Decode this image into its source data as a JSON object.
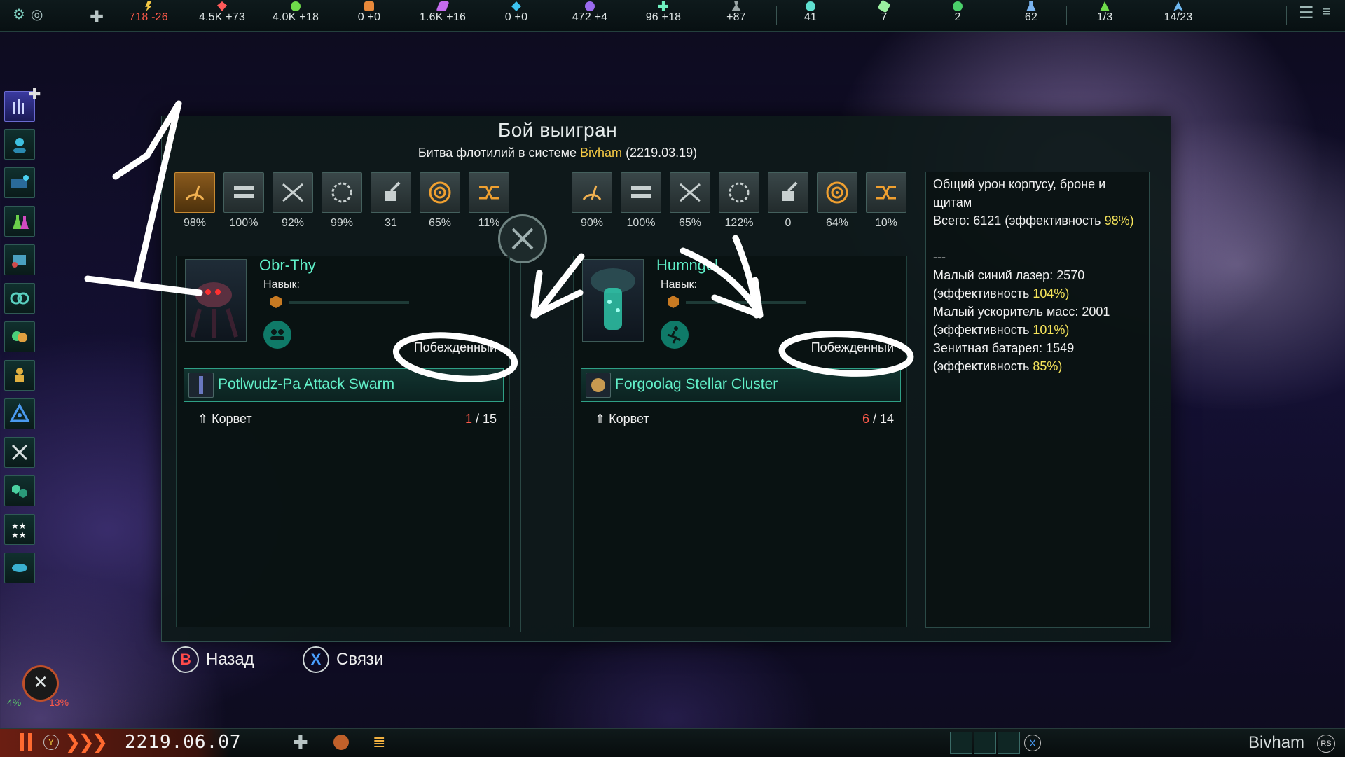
{
  "topbar": {
    "resources": [
      {
        "name": "energy",
        "value": "718 -26",
        "color": "#f2c744",
        "negative": true
      },
      {
        "name": "minerals",
        "value": "4.5K +73",
        "color": "#ff5a5a"
      },
      {
        "name": "food",
        "value": "4.0K +18",
        "color": "#6fdc4a"
      },
      {
        "name": "consumer-goods",
        "value": "0 +0",
        "color": "#e8893a"
      },
      {
        "name": "alloys",
        "value": "1.6K +16",
        "color": "#c56bf0"
      },
      {
        "name": "exotic-gases",
        "value": "0 +0",
        "color": "#3cc3f0"
      },
      {
        "name": "influence",
        "value": "472 +4",
        "color": "#9b6bf0"
      },
      {
        "name": "unity",
        "value": "96 +18",
        "color": "#6ff0c0"
      },
      {
        "name": "research",
        "value": "+87",
        "color": "#9aa6a6"
      },
      {
        "name": "pops",
        "value": "41",
        "color": "#5fe0d0"
      },
      {
        "name": "starbases",
        "value": "7",
        "color": "#9af0a0"
      },
      {
        "name": "planets",
        "value": "2",
        "color": "#4ad06a"
      },
      {
        "name": "leaders",
        "value": "62",
        "color": "#7ab4f0"
      },
      {
        "name": "envoys",
        "value": "1/3",
        "color": "#6fdc4a"
      },
      {
        "name": "fleet-capacity",
        "value": "14/23",
        "color": "#6fb8f0"
      }
    ]
  },
  "dialog": {
    "title": "Бой выигран",
    "subtitle_prefix": "Битва флотилий в системе",
    "system": "Bivham",
    "date": "(2219.03.19)",
    "left": {
      "weapons": [
        "98%",
        "100%",
        "92%",
        "99%",
        "31",
        "65%",
        "11%"
      ],
      "commander": "Obr-Thy",
      "skill_label": "Навык:",
      "status": "Побежденный",
      "fleet_name": "Potlwudz-Pa Attack Swarm",
      "ship_type": "Корвет",
      "ships_lost": "1",
      "ships_total": "/ 15"
    },
    "right": {
      "weapons": [
        "90%",
        "100%",
        "65%",
        "122%",
        "0",
        "64%",
        "10%"
      ],
      "commander": "Humngol",
      "skill_label": "Навык:",
      "status": "Побежденный",
      "fleet_name": "Forgoolag Stellar Cluster",
      "ship_type": "Корвет",
      "ships_lost": "6",
      "ships_total": "/ 14"
    },
    "stats": {
      "header": "Общий урон корпусу, броне и щитам",
      "total_prefix": "Всего: 6121 (эффективность",
      "total_eff": "98%)",
      "separator": "---",
      "rows": [
        {
          "name": "Малый синий лазер: 2570",
          "eff_prefix": "(эффективность ",
          "eff": "104%)"
        },
        {
          "name": "Малый ускоритель масс: 2001",
          "eff_prefix": "(эффективность ",
          "eff": "101%)"
        },
        {
          "name": "Зенитная батарея: 1549",
          "eff_prefix": "(эффективность ",
          "eff": "85%)"
        }
      ]
    }
  },
  "buttons": {
    "back_key": "B",
    "back": "Назад",
    "relations_key": "X",
    "relations": "Связи"
  },
  "bottombar": {
    "pause_key": "Y",
    "date": "2219.06.07",
    "location": "Bivham",
    "stick_key": "RS",
    "x_key": "X"
  },
  "war_indicator": {
    "left": "4%",
    "right": "13%"
  },
  "colors": {
    "accent": "#5ff0c8",
    "warning": "#ff5b4b",
    "highlight": "#f2c744"
  }
}
